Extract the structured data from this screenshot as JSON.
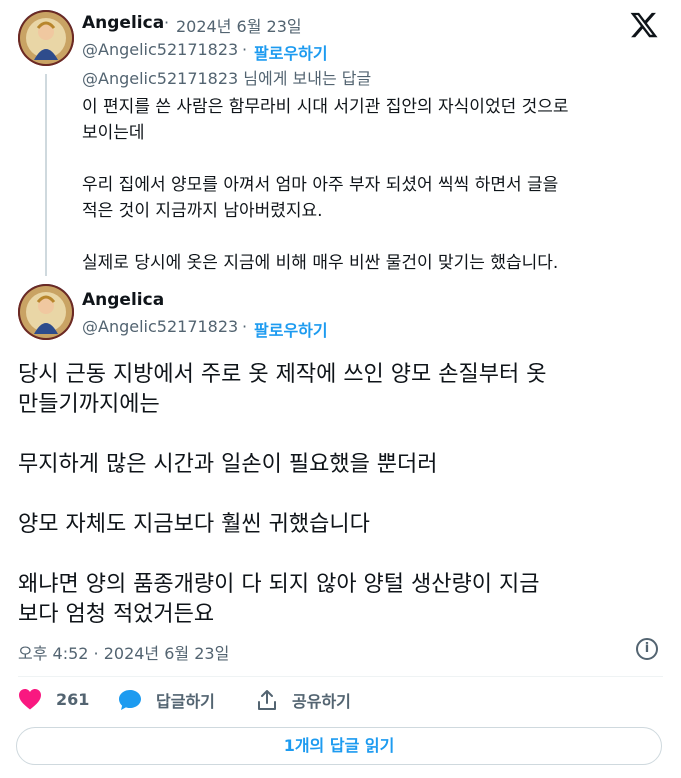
{
  "reply_tweet": {
    "author_name": "Angelica",
    "separator": "·",
    "date": "2024년 6월 23일",
    "handle": "@Angelic52171823",
    "follow_label": "팔로우하기",
    "reply_to_handle": "@Angelic52171823",
    "reply_to_suffix": " 님에게 보내는 답글",
    "lines": [
      "이 편지를 쓴 사람은 함무라비 시대 서기관 집안의 자식이었던 것으로",
      "보이는데",
      "우리 집에서 양모를 아껴서 엄마 아주 부자 되셨어 씩씩 하면서 글을",
      "적은 것이 지금까지 남아버렸지요.",
      "실제로 당시에 옷은 지금에 비해 매우 비싼 물건이 맞기는 했습니다."
    ]
  },
  "main_tweet": {
    "author_name": "Angelica",
    "handle": "@Angelic52171823",
    "follow_label": "팔로우하기",
    "lines": [
      "당시 근동 지방에서 주로 옷 제작에 쓰인 양모 손질부터 옷",
      "만들기까지에는",
      "무지하게 많은 시간과 일손이 필요했을 뿐더러",
      "양모 자체도 지금보다 훨씬 귀했습니다",
      "왜냐면 양의 품종개량이 다 되지 않아 양털 생산량이 지금",
      "보다 엄청 적었거든요"
    ],
    "timestamp": "오후 4:52 · 2024년 6월 23일",
    "info_glyph": "i"
  },
  "actions": {
    "like_count": "261",
    "reply_label": "답글하기",
    "share_label": "공유하기"
  },
  "read_replies_label": "1개의 답글 읽기",
  "colors": {
    "accent": "#1d9bf0",
    "like": "#f91880",
    "muted": "#536471",
    "text": "#0f1419"
  },
  "icons": [
    "x-logo-icon",
    "heart-icon",
    "speech-bubble-icon",
    "share-icon",
    "info-icon"
  ]
}
